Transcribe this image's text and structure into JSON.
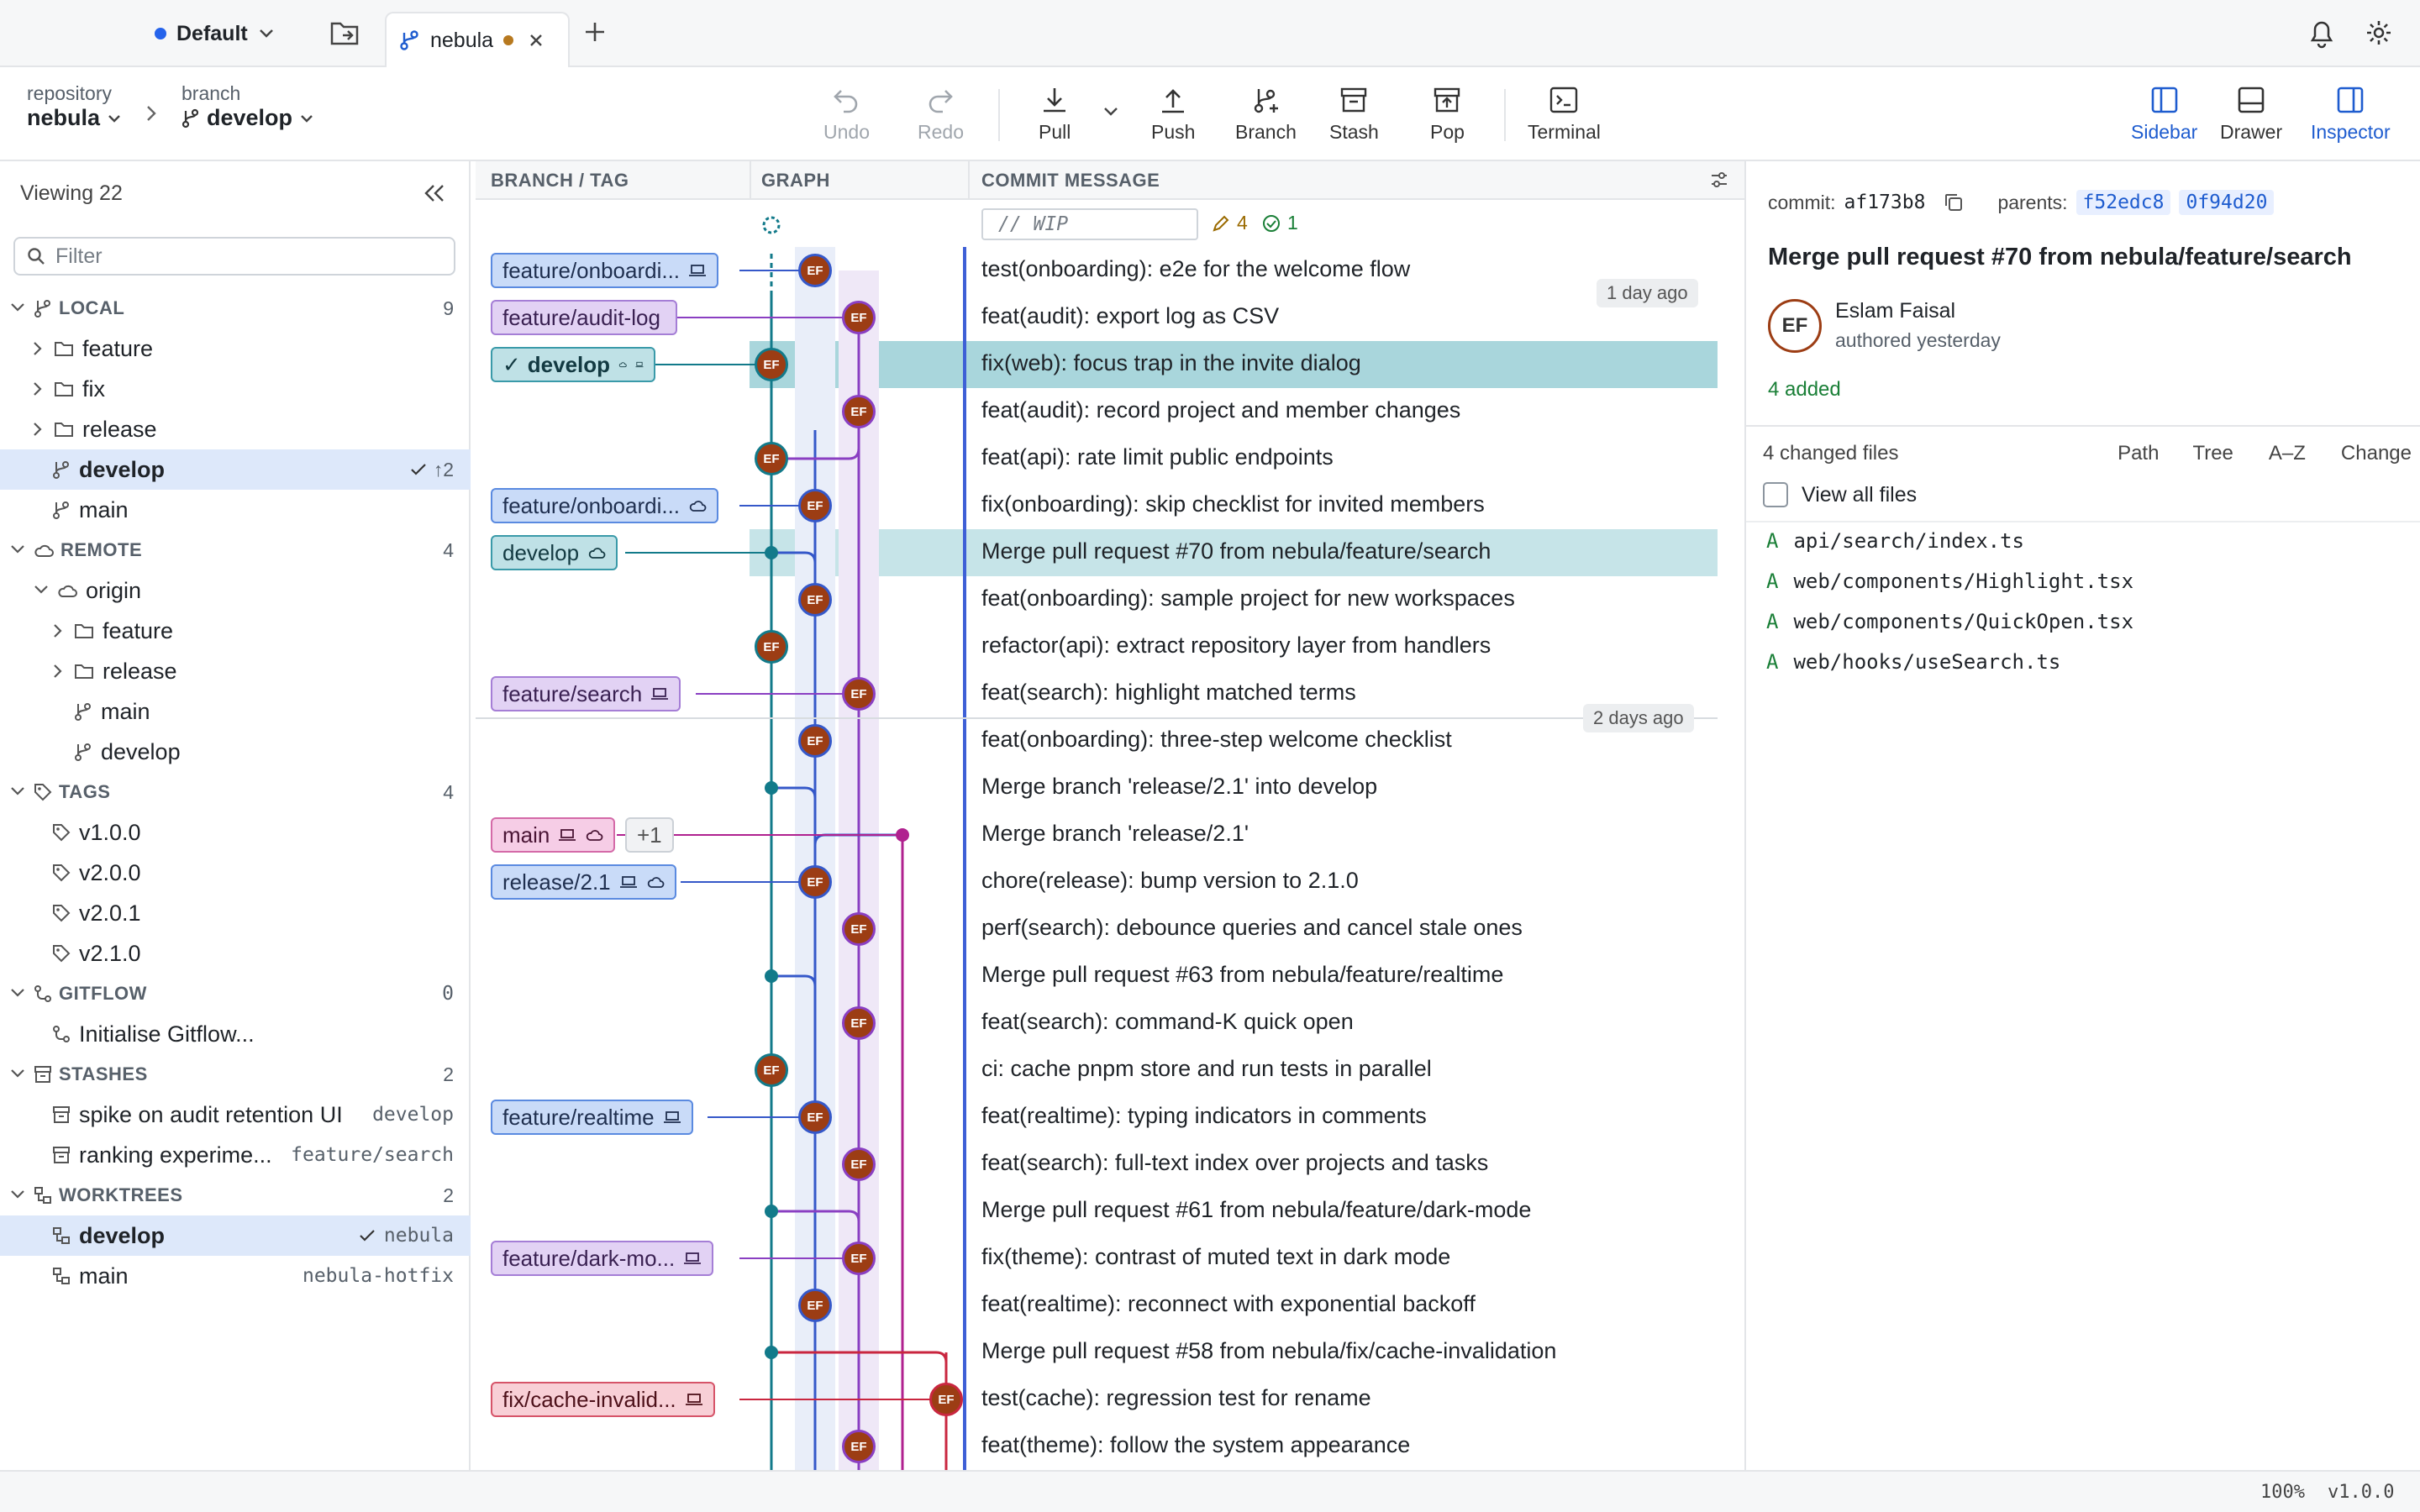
{
  "tabbar": {
    "workspace": "Default",
    "tab_title": "nebula"
  },
  "toolbar": {
    "repo_label": "repository",
    "repo_value": "nebula",
    "branch_label": "branch",
    "branch_value": "develop",
    "buttons": {
      "undo": "Undo",
      "redo": "Redo",
      "pull": "Pull",
      "push": "Push",
      "branch": "Branch",
      "stash": "Stash",
      "pop": "Pop",
      "terminal": "Terminal"
    },
    "views": {
      "sidebar": "Sidebar",
      "drawer": "Drawer",
      "inspector": "Inspector"
    }
  },
  "sidebar": {
    "viewing": "Viewing 22",
    "filter_placeholder": "Filter",
    "local": {
      "label": "LOCAL",
      "count": "9",
      "folders": [
        "feature",
        "fix",
        "release"
      ],
      "branches": [
        {
          "name": "develop",
          "status": "↑2"
        },
        {
          "name": "main"
        }
      ]
    },
    "remote": {
      "label": "REMOTE",
      "count": "4",
      "origin": "origin",
      "folders": [
        "feature",
        "release"
      ],
      "branches": [
        "main",
        "develop"
      ]
    },
    "tags": {
      "label": "TAGS",
      "count": "4",
      "items": [
        "v1.0.0",
        "v2.0.0",
        "v2.0.1",
        "v2.1.0"
      ]
    },
    "gitflow": {
      "label": "GITFLOW",
      "count": "0",
      "action": "Initialise Gitflow..."
    },
    "stashes": {
      "label": "STASHES",
      "count": "2",
      "items": [
        {
          "name": "spike on audit retention UI",
          "branch": "develop"
        },
        {
          "name": "ranking experime...",
          "branch": "feature/search"
        }
      ]
    },
    "worktrees": {
      "label": "WORKTREES",
      "count": "2",
      "items": [
        {
          "name": "develop",
          "path": "nebula"
        },
        {
          "name": "main",
          "path": "nebula-hotfix"
        }
      ]
    }
  },
  "graph": {
    "headers": {
      "branch": "BRANCH / TAG",
      "graph": "GRAPH",
      "message": "COMMIT MESSAGE"
    },
    "wip": {
      "placeholder": "// WIP",
      "edits": "4",
      "checks": "1"
    },
    "avatar": "EF",
    "dates": [
      "1 day ago",
      "2 days ago"
    ],
    "extra_ref": "+1",
    "refs": [
      "feature/onboardi...",
      "feature/audit-log",
      "develop",
      "feature/onboardi...",
      "develop",
      "feature/search",
      "main",
      "release/2.1",
      "feature/realtime",
      "feature/dark-mo...",
      "fix/cache-invalid..."
    ],
    "messages": [
      "test(onboarding): e2e for the welcome flow",
      "feat(audit): export log as CSV",
      "fix(web): focus trap in the invite dialog",
      "feat(audit): record project and member changes",
      "feat(api): rate limit public endpoints",
      "fix(onboarding): skip checklist for invited members",
      "Merge pull request #70 from nebula/feature/search",
      "feat(onboarding): sample project for new workspaces",
      "refactor(api): extract repository layer from handlers",
      "feat(search): highlight matched terms",
      "feat(onboarding): three-step welcome checklist",
      "Merge branch 'release/2.1' into develop",
      "Merge branch 'release/2.1'",
      "chore(release): bump version to 2.1.0",
      "perf(search): debounce queries and cancel stale ones",
      "Merge pull request #63 from nebula/feature/realtime",
      "feat(search): command-K quick open",
      "ci: cache pnpm store and run tests in parallel",
      "feat(realtime): typing indicators in comments",
      "feat(search): full-text index over projects and tasks",
      "Merge pull request #61 from nebula/feature/dark-mode",
      "fix(theme): contrast of muted text in dark mode",
      "feat(realtime): reconnect with exponential backoff",
      "Merge pull request #58 from nebula/fix/cache-invalidation",
      "test(cache): regression test for rename",
      "feat(theme): follow the system appearance"
    ]
  },
  "inspector": {
    "commit_label": "commit:",
    "commit_hash": "af173b8",
    "parents_label": "parents:",
    "parents": [
      "f52edc8",
      "0f94d20"
    ],
    "title": "Merge pull request #70 from nebula/feature/search",
    "avatar": "EF",
    "author": "Eslam Faisal",
    "authored": "authored yesterday",
    "added": "4 added",
    "changed_files": "4 changed files",
    "sorts": [
      "Path",
      "Tree",
      "A–Z",
      "Change"
    ],
    "view_all": "View all files",
    "files": [
      {
        "status": "A",
        "path": "api/search/index.ts"
      },
      {
        "status": "A",
        "path": "web/components/Highlight.tsx"
      },
      {
        "status": "A",
        "path": "web/components/QuickOpen.tsx"
      },
      {
        "status": "A",
        "path": "web/hooks/useSearch.ts"
      }
    ]
  },
  "status": {
    "zoom": "100%",
    "version": "v1.0.0"
  },
  "colors": {
    "accent": "#1e5ccf",
    "teal": "#127a8a",
    "avatar": "#9c3d14",
    "selected_row": "#b7dbe1"
  }
}
